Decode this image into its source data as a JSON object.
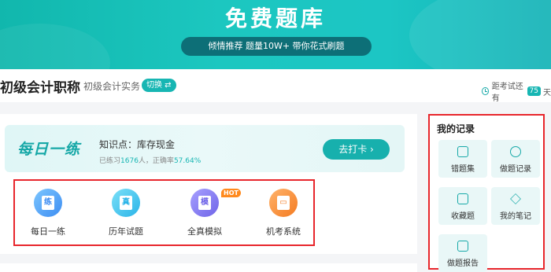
{
  "banner": {
    "title": "免费题库",
    "slogan": "倾情推荐 题量10W+ 带你花式刷题"
  },
  "header": {
    "title": "初级会计职称",
    "subject": "初级会计实务",
    "switch_label": "切换 ⇄",
    "countdown_prefix": "距考试还有",
    "countdown_days": "75",
    "countdown_suffix": "天"
  },
  "daily": {
    "title": "每日一练",
    "knowledge": "知识点：库存现金",
    "practiced_prefix": "已练习",
    "practiced_count": "1676",
    "practiced_suffix": "人，正确率",
    "accuracy": "57.64%",
    "button_label": "去打卡 ›"
  },
  "tools": [
    {
      "label": "每日一练",
      "glyph": "练",
      "icon": "calendar-practice-icon"
    },
    {
      "label": "历年试题",
      "glyph": "真",
      "icon": "past-exam-icon"
    },
    {
      "label": "全真模拟",
      "glyph": "模",
      "icon": "mock-exam-icon",
      "badge": "HOT"
    },
    {
      "label": "机考系统",
      "glyph": "▭",
      "icon": "computer-exam-icon"
    }
  ],
  "records": {
    "title": "我的记录",
    "items": [
      {
        "label": "错题集",
        "icon": "wrong-questions-icon"
      },
      {
        "label": "做题记录",
        "icon": "practice-history-icon"
      },
      {
        "label": "收藏题",
        "icon": "favorites-icon"
      },
      {
        "label": "我的笔记",
        "icon": "notes-icon"
      },
      {
        "label": "做题报告",
        "icon": "report-icon"
      }
    ]
  },
  "colors": {
    "accent": "#17b6b3",
    "highlight_border": "#e8262c",
    "hot_badge": "#ff8a1e"
  }
}
